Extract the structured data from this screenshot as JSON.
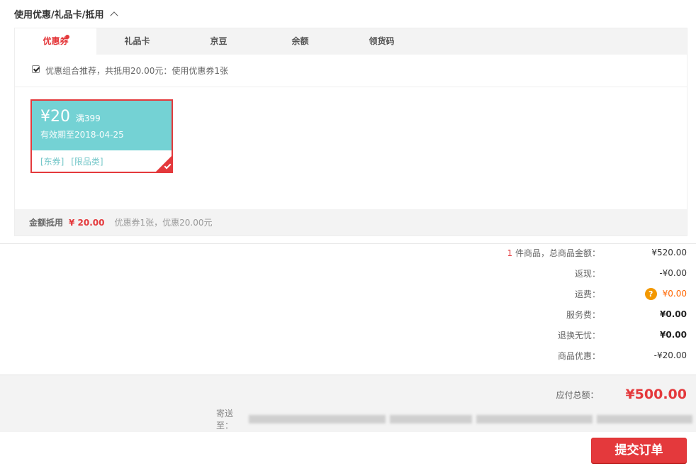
{
  "section": {
    "title": "使用优惠/礼品卡/抵用"
  },
  "tabs": [
    {
      "label": "优惠券"
    },
    {
      "label": "礼品卡"
    },
    {
      "label": "京豆"
    },
    {
      "label": "余额"
    },
    {
      "label": "领货码"
    }
  ],
  "combo": {
    "text": "优惠组合推荐，共抵用20.00元：使用优惠券1张",
    "checked": true
  },
  "coupon": {
    "amount": "¥20",
    "condition": "满399",
    "expiry": "有效期至2018-04-25",
    "tags": [
      "[东券]",
      "[限品类]"
    ],
    "selected": true
  },
  "summary": {
    "label": "金额抵用",
    "amount": "¥ 20.00",
    "desc": "优惠券1张，优惠20.00元"
  },
  "prices": [
    {
      "count": "1",
      "label": " 件商品，总商品金额：",
      "value": "¥520.00"
    },
    {
      "label": "返现：",
      "value": "-¥0.00"
    },
    {
      "label": "运费：",
      "value": "¥0.00"
    },
    {
      "label": "服务费：",
      "value": "¥0.00"
    },
    {
      "label": "退换无忧：",
      "value": "¥0.00"
    },
    {
      "label": "商品优惠：",
      "value": "-¥20.00"
    }
  ],
  "total": {
    "label": "应付总额：",
    "amount": "¥500.00"
  },
  "address": {
    "label": "寄送至："
  },
  "submit": {
    "label": "提交订单"
  },
  "colors": {
    "accent": "#e4393c",
    "coupon_bg": "#74d2d4",
    "warning": "#f39800"
  },
  "icons": {
    "collapse": "chevron-up-icon",
    "shipping_help": "question-icon",
    "selected_corner": "check-icon"
  }
}
